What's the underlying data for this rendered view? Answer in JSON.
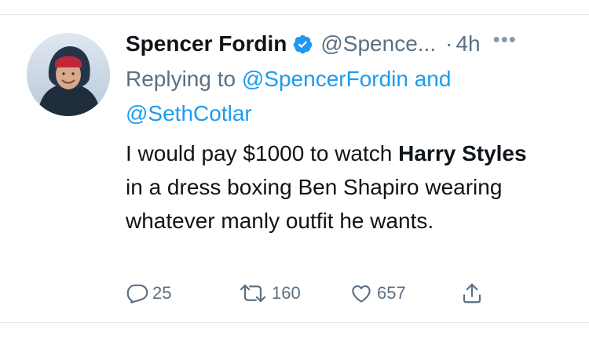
{
  "tweet": {
    "author_name": "Spencer Fordin",
    "handle": "@Spence...",
    "separator": "·",
    "time": "4h",
    "more_label": "•••",
    "reply_prefix": "Replying to",
    "reply_mention_1": "@SpencerFordin",
    "reply_and": "and",
    "reply_mention_2": "@SethCotlar",
    "text_part_1": "I would pay $1000 to watch",
    "text_bold": "Harry Styles",
    "text_part_2": "in a dress boxing Ben Shapiro wearing whatever manly outfit he wants."
  },
  "actions": {
    "replies": "25",
    "retweets": "160",
    "likes": "657"
  },
  "colors": {
    "accent": "#1d9bf0",
    "secondary_text": "#5b7083",
    "divider": "#e3e6e8"
  },
  "icons": [
    "verified-badge-icon",
    "more-icon",
    "reply-icon",
    "retweet-icon",
    "like-icon",
    "share-icon"
  ]
}
